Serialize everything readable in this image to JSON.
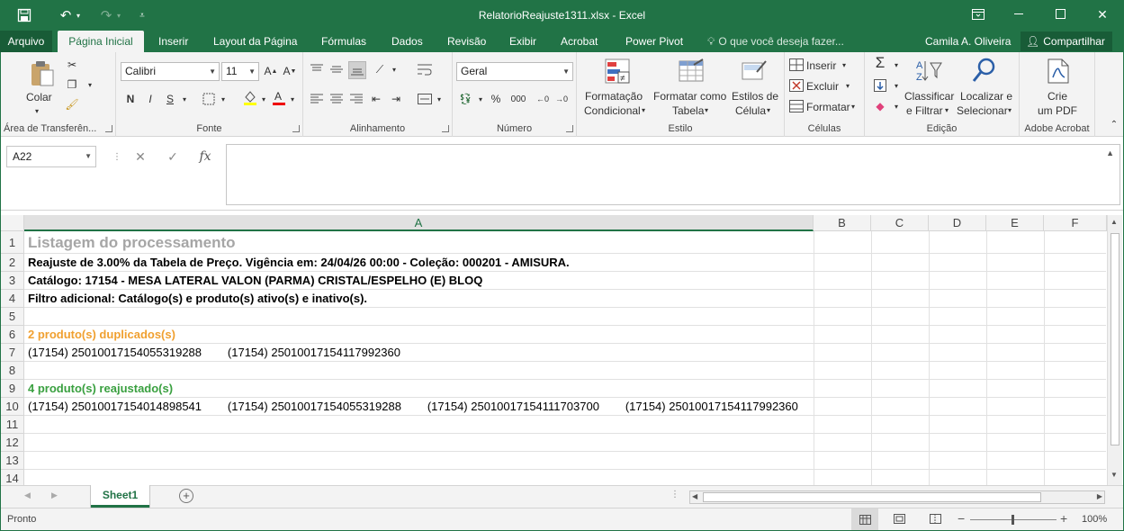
{
  "window": {
    "title": "RelatorioReajuste1311.xlsx - Excel",
    "qat_icons": [
      "save-icon",
      "undo-icon",
      "redo-icon",
      "customize-qat-icon"
    ],
    "controls": [
      "ribbon-display-icon",
      "minimize-icon",
      "restore-icon",
      "close-icon"
    ]
  },
  "tabs": {
    "file": "Arquivo",
    "items": [
      "Página Inicial",
      "Inserir",
      "Layout da Página",
      "Fórmulas",
      "Dados",
      "Revisão",
      "Exibir",
      "Acrobat",
      "Power Pivot"
    ],
    "active": "Página Inicial",
    "tell_me": "O que você deseja fazer...",
    "user": "Camila A. Oliveira",
    "share": "Compartilhar"
  },
  "ribbon": {
    "clipboard": {
      "label": "Área de Transferên...",
      "paste": "Colar"
    },
    "font": {
      "label": "Fonte",
      "font_name": "Calibri",
      "font_size": "11",
      "bold": "N",
      "italic": "I",
      "underline": "S"
    },
    "alignment": {
      "label": "Alinhamento"
    },
    "number": {
      "label": "Número",
      "format": "Geral",
      "percent": "%",
      "thousands": "000"
    },
    "styles": {
      "label": "Estilo",
      "conditional_1": "Formatação",
      "conditional_2": "Condicional",
      "table_1": "Formatar como",
      "table_2": "Tabela",
      "cell_styles_1": "Estilos de",
      "cell_styles_2": "Célula"
    },
    "cells": {
      "label": "Células",
      "insert": "Inserir",
      "delete": "Excluir",
      "format": "Formatar"
    },
    "editing": {
      "label": "Edição",
      "sort_1": "Classificar",
      "sort_2": "e Filtrar",
      "find_1": "Localizar e",
      "find_2": "Selecionar"
    },
    "acrobat": {
      "label": "Adobe Acrobat",
      "create_1": "Crie",
      "create_2": "um PDF"
    }
  },
  "formula_bar": {
    "name_box": "A22",
    "fx": "fx",
    "content": ""
  },
  "sheet": {
    "columns": [
      "A",
      "B",
      "C",
      "D",
      "E",
      "F"
    ],
    "selected_column": "A",
    "rows": [
      {
        "num": "1",
        "text": "Listagem do processamento"
      },
      {
        "num": "2",
        "text": "Reajuste de 3.00% da Tabela de Preço. Vigência em: 24/04/26 00:00 - Coleção: 000201 - AMISURA."
      },
      {
        "num": "3",
        "text": "Catálogo: 17154 - MESA LATERAL VALON (PARMA) CRISTAL/ESPELHO (E) BLOQ"
      },
      {
        "num": "4",
        "text": "Filtro adicional: Catálogo(s) e produto(s) ativo(s) e inativo(s)."
      },
      {
        "num": "5",
        "text": ""
      },
      {
        "num": "6",
        "text": "2 produto(s) duplicados(s)"
      },
      {
        "num": "7",
        "text": "(17154) 25010017154055319288        (17154) 25010017154117992360"
      },
      {
        "num": "8",
        "text": ""
      },
      {
        "num": "9",
        "text": "4 produto(s) reajustado(s)"
      },
      {
        "num": "10",
        "text": "(17154) 25010017154014898541        (17154) 25010017154055319288        (17154) 25010017154111703700        (17154) 25010017154117992360"
      },
      {
        "num": "11",
        "text": ""
      },
      {
        "num": "12",
        "text": ""
      },
      {
        "num": "13",
        "text": ""
      },
      {
        "num": "14",
        "text": ""
      }
    ]
  },
  "sheet_tabs": {
    "active": "Sheet1"
  },
  "status_bar": {
    "state": "Pronto",
    "zoom": "100%"
  },
  "colors": {
    "accent": "#217346",
    "duplicates": "#f0a030",
    "adjusted": "#3aa040",
    "title_gray": "#a6a6a6"
  }
}
